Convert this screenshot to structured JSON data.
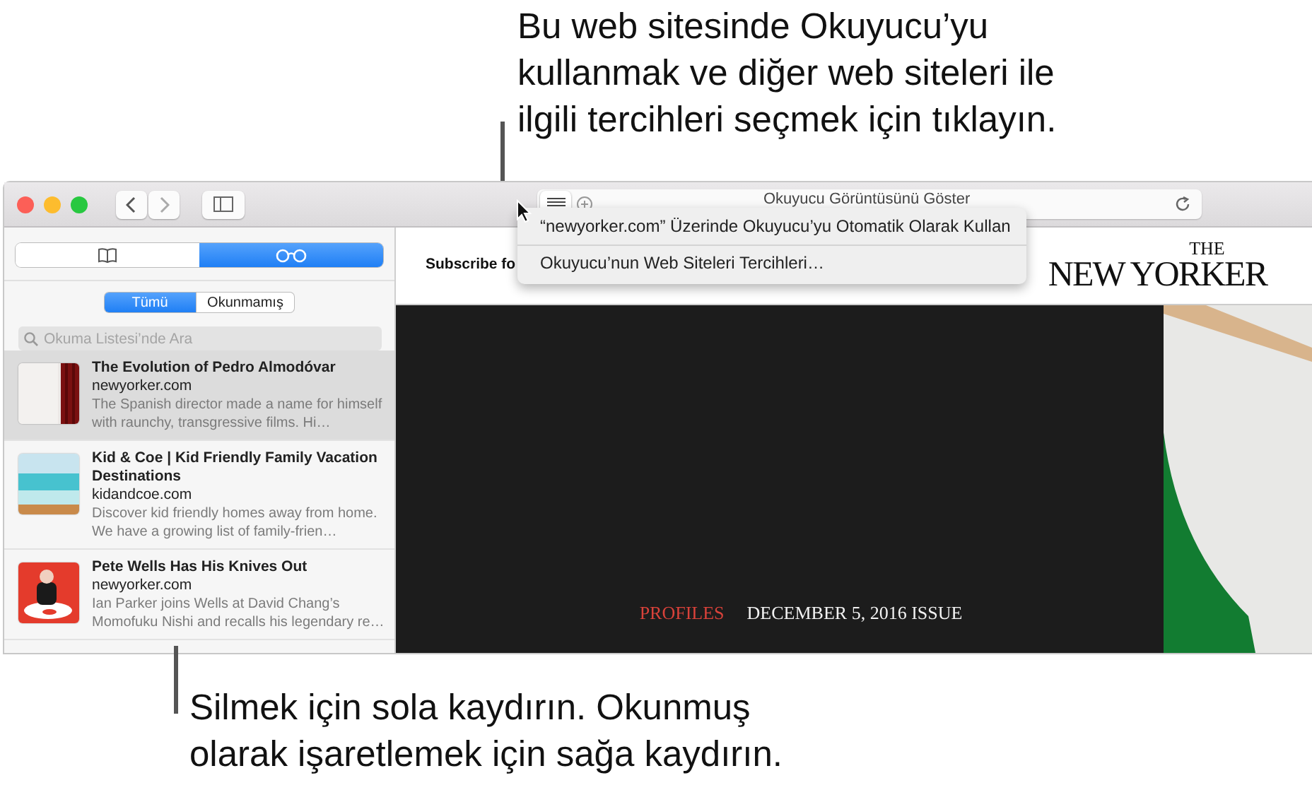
{
  "callout_top": {
    "lines": [
      "Bu web sitesinde Okuyucu’yu",
      "kullanmak ve diğer web siteleri ile",
      "ilgili tercihleri seçmek için tıklayın."
    ]
  },
  "window": {
    "address": "Okuyucu Görüntüsünü Göster"
  },
  "sidebar": {
    "tabs": [
      {
        "kind": "bookmarks",
        "selected": false
      },
      {
        "kind": "reading-list",
        "selected": true
      }
    ],
    "filters": [
      {
        "label": "Tümü",
        "selected": true
      },
      {
        "label": "Okunmamış",
        "selected": false
      }
    ],
    "search": {
      "placeholder": "Okuma Listesi’nde Ara"
    },
    "items": [
      {
        "title": "The Evolution of Pedro Almodóvar",
        "site": "newyorker.com",
        "summary": "The Spanish director made a name for himself with raunchy, transgressive films. Hi…",
        "selected": true
      },
      {
        "title": "Kid & Coe | Kid Friendly Family Vacation Destinations",
        "site": "kidandcoe.com",
        "summary": "Discover kid friendly homes away from home. We have a growing list of family-frien…",
        "selected": false
      },
      {
        "title": "Pete Wells Has His Knives Out",
        "site": "newyorker.com",
        "summary": "Ian Parker joins Wells at David Chang’s Momofuku Nishi and recalls his legendary re…",
        "selected": false
      }
    ]
  },
  "menu": {
    "items": [
      "“newyorker.com” Üzerinde Okuyucu’yu Otomatik Olarak Kullan",
      "Okuyucu’nun Web Siteleri Tercihleri…"
    ]
  },
  "page": {
    "subscribe": "Subscribe fo",
    "logo_small": "THE",
    "logo": "NEW YORKER",
    "section": "PROFILES",
    "issue": "DECEMBER 5, 2016 ISSUE"
  },
  "callout_bottom": {
    "lines": [
      "Silmek için sola kaydırın. Okunmuş",
      "olarak işaretlemek için sağa kaydırın."
    ]
  }
}
